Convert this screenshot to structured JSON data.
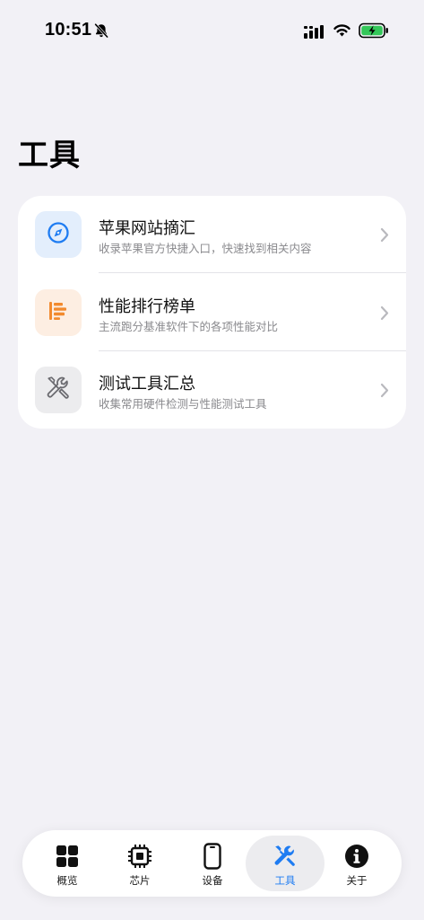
{
  "status_bar": {
    "time": "10:51"
  },
  "page": {
    "title": "工具"
  },
  "items": [
    {
      "title": "苹果网站摘汇",
      "subtitle": "收录苹果官方快捷入口，快速找到相关内容",
      "icon": "compass-icon",
      "icon_color": "#1e7cf2",
      "icon_bg": "#e3eefc"
    },
    {
      "title": "性能排行榜单",
      "subtitle": "主流跑分基准软件下的各项性能对比",
      "icon": "ranking-bars-icon",
      "icon_color": "#f28a2e",
      "icon_bg": "#fdeee2"
    },
    {
      "title": "测试工具汇总",
      "subtitle": "收集常用硬件检测与性能测试工具",
      "icon": "tools-icon",
      "icon_color": "#6b6b70",
      "icon_bg": "#ececee"
    }
  ],
  "tab_bar": {
    "active_index": 3,
    "active_color": "#1e7cf2",
    "tabs": [
      {
        "label": "概览",
        "icon": "grid-icon"
      },
      {
        "label": "芯片",
        "icon": "chip-icon"
      },
      {
        "label": "设备",
        "icon": "phone-icon"
      },
      {
        "label": "工具",
        "icon": "tools-icon"
      },
      {
        "label": "关于",
        "icon": "info-icon"
      }
    ]
  }
}
